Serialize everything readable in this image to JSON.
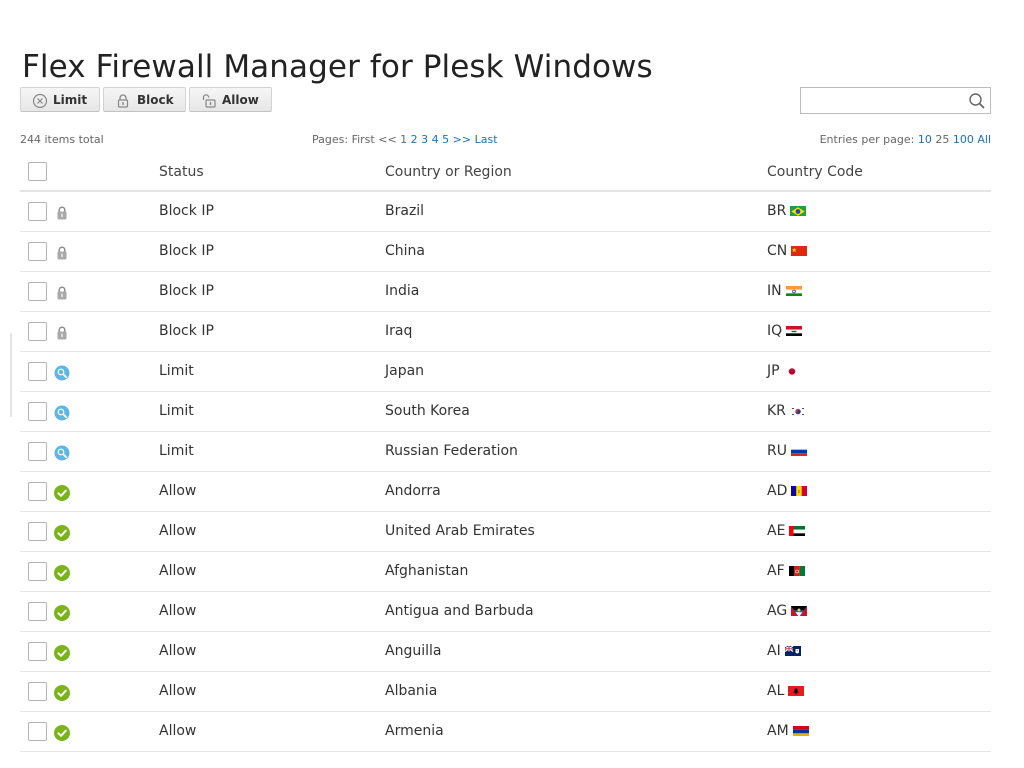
{
  "page": {
    "title": "Flex Firewall Manager for Plesk Windows"
  },
  "toolbar": {
    "limit_label": "Limit",
    "block_label": "Block",
    "allow_label": "Allow"
  },
  "search": {
    "value": "",
    "placeholder": ""
  },
  "meta": {
    "items_total": "244 items total",
    "pages_label": "Pages:",
    "pages_first": "First",
    "pages_prev": "<<",
    "pages_current": "1",
    "pages": [
      "2",
      "3",
      "4",
      "5"
    ],
    "pages_next": ">>",
    "pages_last": "Last",
    "entries_label": "Entries per page:",
    "entries_current": "10",
    "entries_options": [
      "25",
      "100",
      "All"
    ]
  },
  "table": {
    "headers": {
      "status": "Status",
      "country": "Country or Region",
      "code": "Country Code"
    },
    "rows": [
      {
        "status": "Block IP",
        "icon": "lock-icon",
        "country": "Brazil",
        "code": "BR"
      },
      {
        "status": "Block IP",
        "icon": "lock-icon",
        "country": "China",
        "code": "CN"
      },
      {
        "status": "Block IP",
        "icon": "lock-icon",
        "country": "India",
        "code": "IN"
      },
      {
        "status": "Block IP",
        "icon": "lock-icon",
        "country": "Iraq",
        "code": "IQ"
      },
      {
        "status": "Limit",
        "icon": "limit-icon",
        "country": "Japan",
        "code": "JP"
      },
      {
        "status": "Limit",
        "icon": "limit-icon",
        "country": "South Korea",
        "code": "KR"
      },
      {
        "status": "Limit",
        "icon": "limit-icon",
        "country": "Russian Federation",
        "code": "RU"
      },
      {
        "status": "Allow",
        "icon": "allow-icon",
        "country": "Andorra",
        "code": "AD"
      },
      {
        "status": "Allow",
        "icon": "allow-icon",
        "country": "United Arab Emirates",
        "code": "AE"
      },
      {
        "status": "Allow",
        "icon": "allow-icon",
        "country": "Afghanistan",
        "code": "AF"
      },
      {
        "status": "Allow",
        "icon": "allow-icon",
        "country": "Antigua and Barbuda",
        "code": "AG"
      },
      {
        "status": "Allow",
        "icon": "allow-icon",
        "country": "Anguilla",
        "code": "AI"
      },
      {
        "status": "Allow",
        "icon": "allow-icon",
        "country": "Albania",
        "code": "AL"
      },
      {
        "status": "Allow",
        "icon": "allow-icon",
        "country": "Armenia",
        "code": "AM"
      }
    ]
  },
  "colors": {
    "link": "#1a73b8",
    "allow_green": "#7ab31c",
    "limit_blue": "#5db6e4",
    "lock_gray": "#9a9a9a",
    "row_border": "#e6e6e6"
  }
}
